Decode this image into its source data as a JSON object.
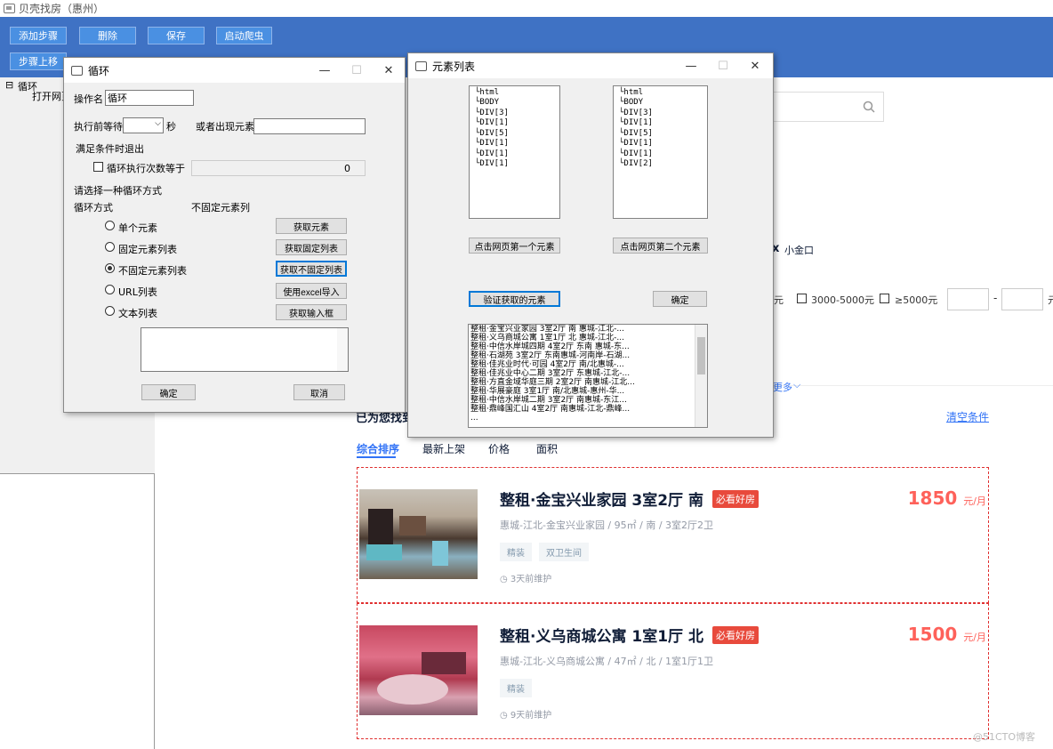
{
  "app": {
    "title": "贝壳找房（惠州）"
  },
  "toolbar": {
    "add_step": "添加步骤",
    "delete": "删除",
    "save": "保存",
    "start_crawler": "启动爬虫",
    "step_up": "步骤上移"
  },
  "tree": {
    "root": "循环",
    "child": "打开网页"
  },
  "loop_dialog": {
    "title": "循环",
    "op_name_label": "操作名",
    "op_name_value": "循环",
    "wait_label": "执行前等待",
    "seconds": "秒",
    "or_element": "或者出现元素",
    "exit_condition": "满足条件时退出",
    "loop_count_label": "循环执行次数等于",
    "loop_count_value": "0",
    "choose_mode": "请选择一种循环方式",
    "mode_label": "循环方式",
    "mode_value": "不固定元素列",
    "options": [
      "单个元素",
      "固定元素列表",
      "不固定元素列表",
      "URL列表",
      "文本列表"
    ],
    "selected_option": "不固定元素列表",
    "buttons": [
      "获取元素",
      "获取固定列表",
      "获取不固定列表",
      "使用excel导入",
      "获取输入框"
    ],
    "ok": "确定",
    "cancel": "取消"
  },
  "element_dialog": {
    "title": "元素列表",
    "tree1": [
      "html",
      "BODY",
      "DIV[3]",
      "DIV[1]",
      "DIV[5]",
      "DIV[1]",
      "DIV[1]",
      "DIV[1]"
    ],
    "tree2": [
      "html",
      "BODY",
      "DIV[3]",
      "DIV[1]",
      "DIV[5]",
      "DIV[1]",
      "DIV[1]",
      "DIV[2]"
    ],
    "btn_first": "点击网页第一个元素",
    "btn_second": "点击网页第二个元素",
    "btn_verify": "验证获取的元素",
    "btn_ok": "确定",
    "results": [
      "整租·金宝兴业家园 3室2厅 南 惠城-江北-...",
      "整租·义乌商城公寓 1室1厅 北 惠城-江北-...",
      "整租·中信水岸城四期 4室2厅 东南 惠城-东...",
      "整租·石湖苑 3室2厅 东南惠城-河南岸-石湖...",
      "整租·佳兆业时代·可园 4室2厅 南/北惠城-...",
      "整租·佳兆业中心二期 3室2厅 东惠城-江北-...",
      "整租·方直金域华庭三期 2室2厅 南惠城-江北...",
      "整租·华展豪庭 3室1厅 南/北惠城-惠州-华...",
      "整租·中信水岸城二期 3室2厅 南惠城-东江...",
      "整租·鼎峰国汇山 4室2厅 南惠城-江北-鼎峰...",
      "..."
    ]
  },
  "web": {
    "small_gold": "小金口",
    "price_filters": [
      "元",
      "3000-5000元",
      "≥5000元"
    ],
    "more": "更多",
    "found_prefix": "已为您找到",
    "clear": "清空条件",
    "tabs": [
      "综合排序",
      "最新上架",
      "价格",
      "面积"
    ],
    "listings": [
      {
        "title": "整租·金宝兴业家园 3室2厅 南",
        "badge": "必看好房",
        "price": "1850",
        "unit": "元/月",
        "desc": "惠城-江北-金宝兴业家园  /  95㎡  /  南  /  3室2厅2卫",
        "tags": [
          "精装",
          "双卫生间"
        ],
        "time": "3天前维护"
      },
      {
        "title": "整租·义乌商城公寓 1室1厅 北",
        "badge": "必看好房",
        "price": "1500",
        "unit": "元/月",
        "desc": "惠城-江北-义乌商城公寓  /  47㎡  /  北  /  1室1厅1卫",
        "tags": [
          "精装"
        ],
        "time": "9天前维护"
      }
    ],
    "watermark": "@51CTO博客"
  }
}
